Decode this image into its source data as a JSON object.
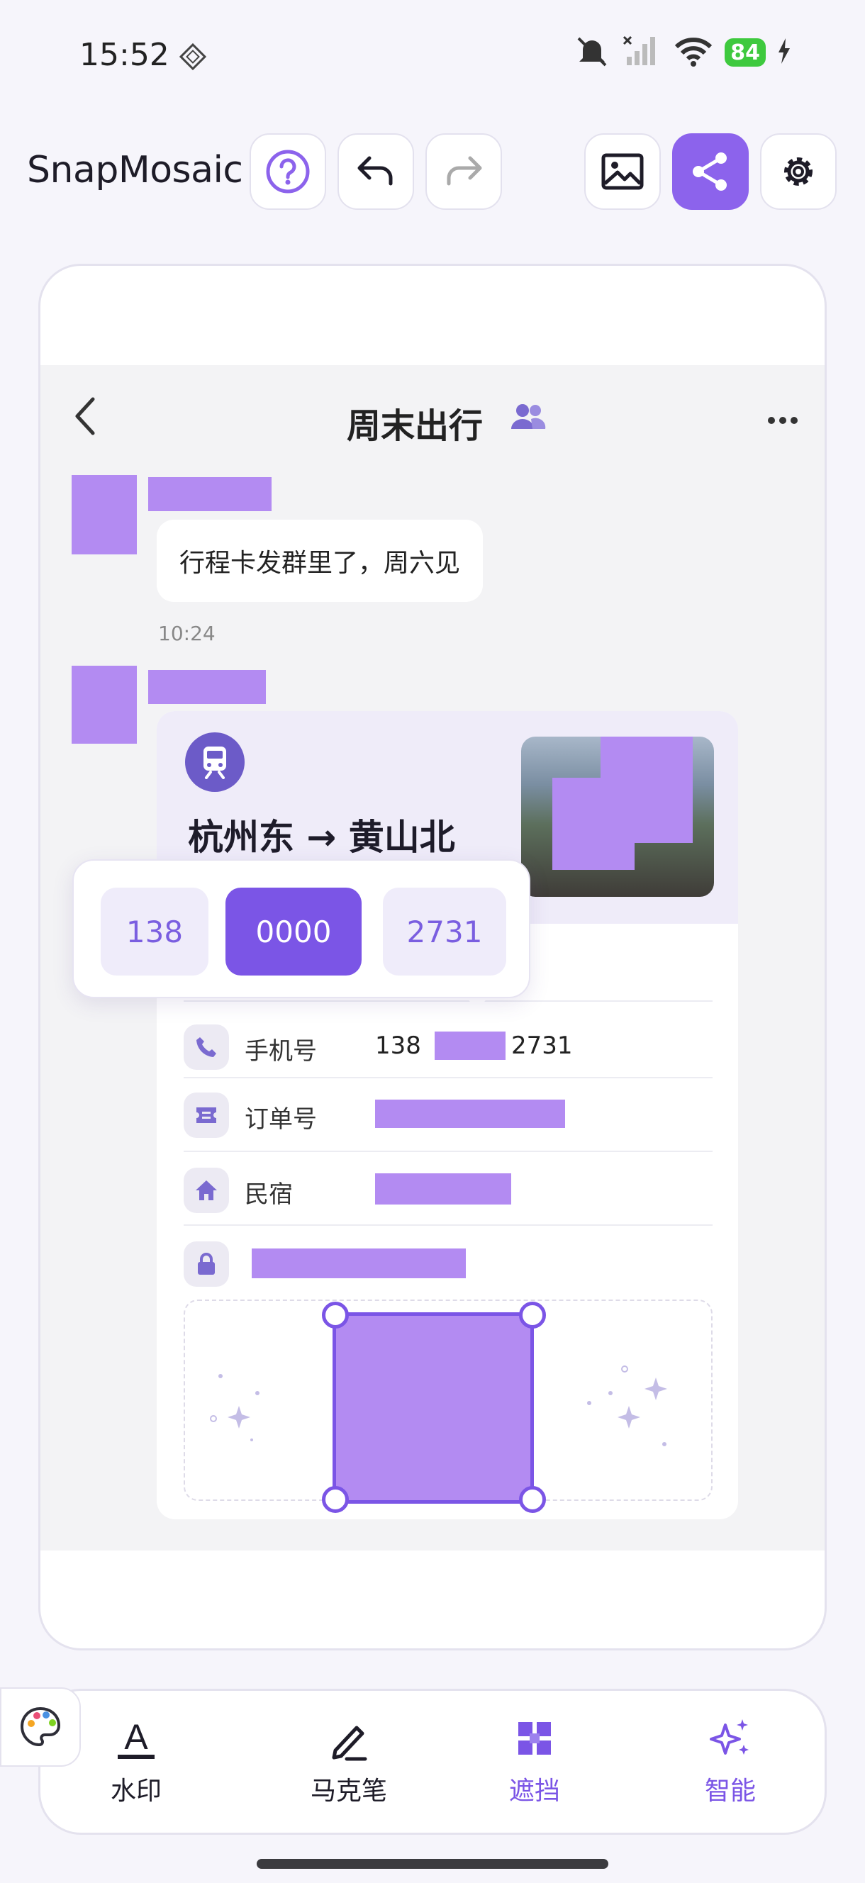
{
  "status_bar": {
    "time": "15:52",
    "battery": "84"
  },
  "toolbar": {
    "app_title": "SnapMosaic"
  },
  "chat": {
    "title": "周末出行",
    "message_text": "行程卡发群里了，周六见",
    "timestamp": "10:24"
  },
  "trip_card": {
    "route": "杭州东 → 黄山北",
    "rows": [
      {
        "label": "手机号",
        "value_prefix": "138",
        "value_suffix": "2731"
      },
      {
        "label": "订单号"
      },
      {
        "label": "民宿"
      }
    ]
  },
  "segment_popup": {
    "segments": [
      "138",
      "0000",
      "2731"
    ],
    "selected_index": 1
  },
  "bottom_tools": [
    {
      "label": "水印",
      "active": false
    },
    {
      "label": "马克笔",
      "active": false
    },
    {
      "label": "遮挡",
      "active": true
    },
    {
      "label": "智能",
      "active": true
    }
  ],
  "colors": {
    "accent": "#8c63ec",
    "mosaic": "#b38bf2",
    "background": "#f6f5fb"
  }
}
